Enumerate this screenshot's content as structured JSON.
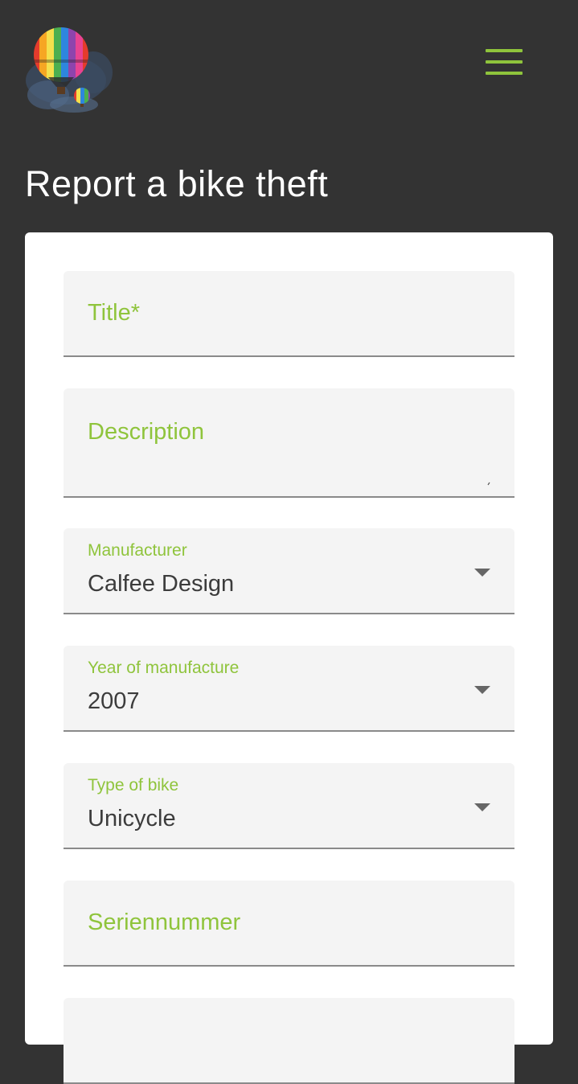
{
  "header": {
    "logo_icon": "hot-air-balloon-logo",
    "menu_icon": "hamburger-menu-icon",
    "accent_color": "#8fc43c"
  },
  "page": {
    "title": "Report a bike theft"
  },
  "form": {
    "title_field": {
      "placeholder": "Title*"
    },
    "description_field": {
      "placeholder": "Description"
    },
    "manufacturer": {
      "label": "Manufacturer",
      "value": "Calfee Design"
    },
    "year": {
      "label": "Year of manufacture",
      "value": "2007"
    },
    "bike_type": {
      "label": "Type of bike",
      "value": "Unicycle"
    },
    "serial_field": {
      "placeholder": "Seriennummer"
    }
  }
}
